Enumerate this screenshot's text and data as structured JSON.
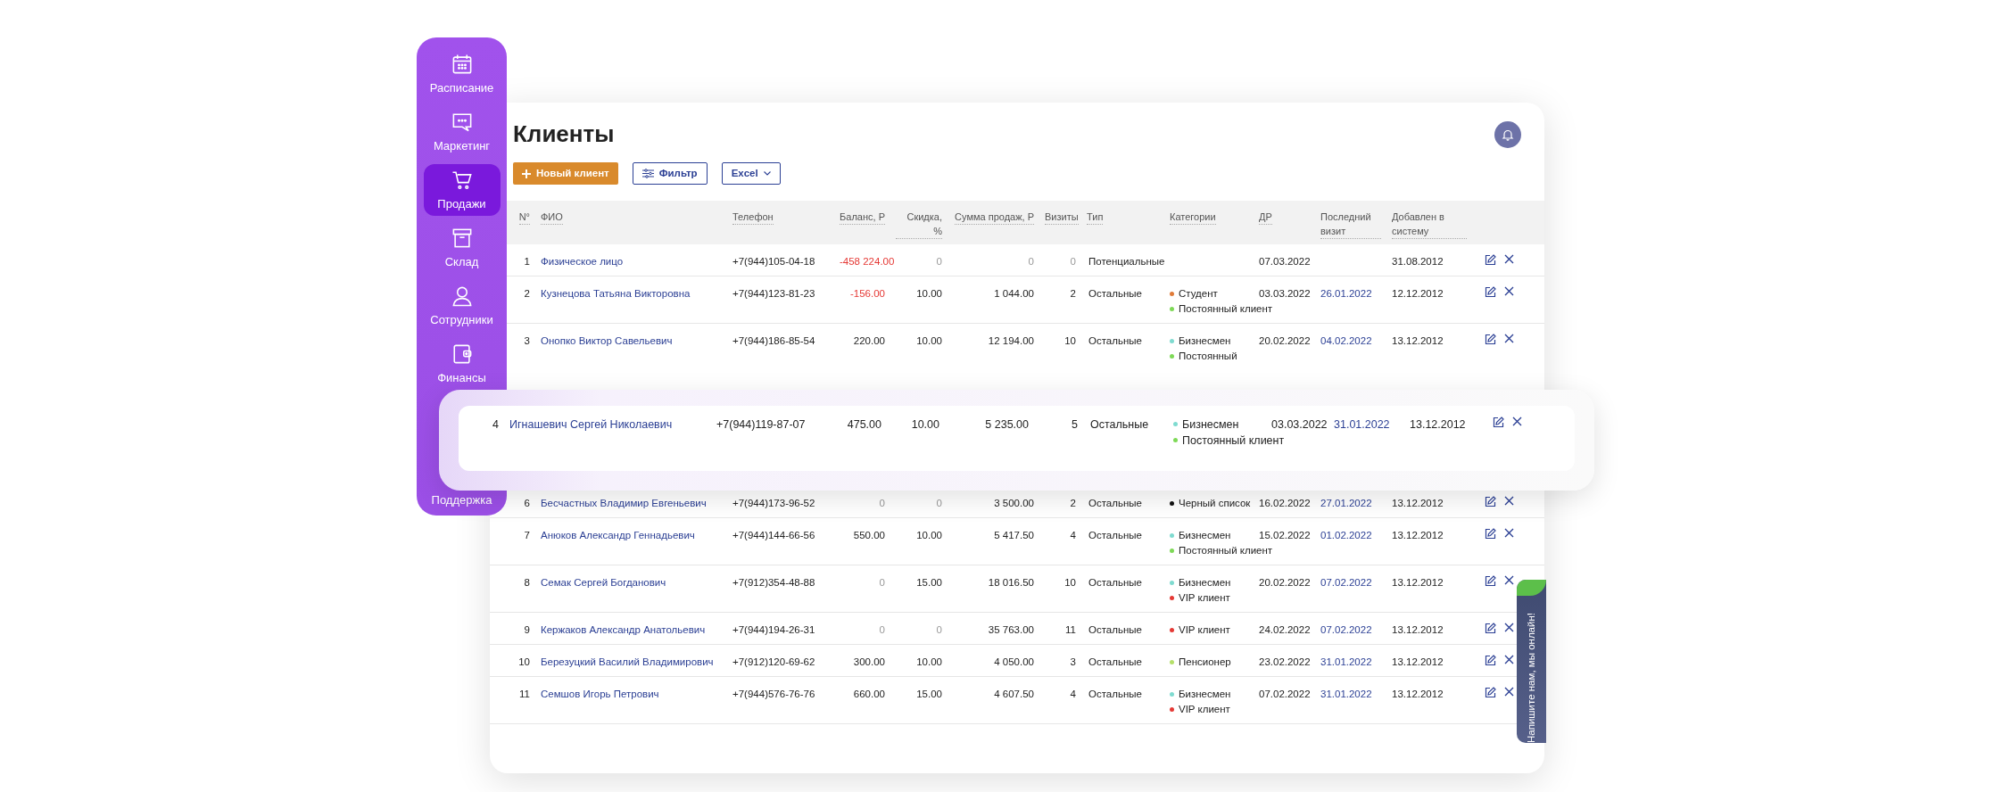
{
  "sidebar": {
    "items": [
      {
        "label": "Расписание",
        "selected": false
      },
      {
        "label": "Маркетинг",
        "selected": false
      },
      {
        "label": "Продажи",
        "selected": true
      },
      {
        "label": "Склад",
        "selected": false
      },
      {
        "label": "Сотрудники",
        "selected": false
      },
      {
        "label": "Финансы",
        "selected": false
      },
      {
        "label": "Поддержка",
        "selected": false
      }
    ]
  },
  "page": {
    "title": "Клиенты"
  },
  "toolbar": {
    "buttons": [
      {
        "label": "Новый клиент",
        "kind": "add"
      },
      {
        "label": "Фильтр",
        "kind": "filter"
      },
      {
        "label": "Excel",
        "kind": "dropdown"
      }
    ]
  },
  "table": {
    "columns": [
      "N°",
      "ФИО",
      "Телефон",
      "Баланс, Р",
      "Скидка, %",
      "Сумма продаж, Р",
      "Визиты",
      "Тип",
      "Категории",
      "ДР",
      "Последний визит",
      "Добавлен в систему"
    ],
    "rows": [
      {
        "number": "1",
        "name": "Физическое лицо",
        "phone": "+7(944)105-04-18",
        "balance": "-458 224.00",
        "balance_negative": true,
        "discount": "0",
        "discount_muted": true,
        "sales": "0",
        "sales_muted": true,
        "visits": "0",
        "visits_muted": true,
        "type": "Потенциальные",
        "categories": [],
        "birthday": "07.03.2022",
        "added": "31.08.2012"
      },
      {
        "number": "2",
        "name": "Кузнецова Татьяна Викторовна",
        "phone": "+7(944)123-81-23",
        "balance": "-156.00",
        "balance_negative": true,
        "discount": "10.00",
        "sales": "1 044.00",
        "visits": "2",
        "type": "Остальные",
        "categories": [
          {
            "label": "Студент",
            "color": "#e07b39"
          },
          {
            "label": "Постоянный клиент",
            "color": "#7ed957"
          }
        ],
        "birthday": "03.03.2022",
        "last_visit": "26.01.2022",
        "added": "12.12.2012"
      },
      {
        "number": "3",
        "name": "Онопко Виктор Савельевич",
        "phone": "+7(944)186-85-54",
        "balance": "220.00",
        "discount": "10.00",
        "sales": "12 194.00",
        "visits": "10",
        "type": "Остальные",
        "categories": [
          {
            "label": "Бизнесмен",
            "color": "#7fdbd0"
          },
          {
            "label": "Постоянный",
            "color": "#7ed957"
          }
        ],
        "birthday": "20.02.2022",
        "last_visit": "04.02.2022",
        "added": "13.12.2012"
      },
      {
        "number": "6",
        "name": "Бесчастных Владимир Евгеньевич",
        "phone": "+7(944)173-96-52",
        "balance": "0",
        "balance_muted": true,
        "discount": "0",
        "discount_muted": true,
        "sales": "3 500.00",
        "visits": "2",
        "type": "Остальные",
        "categories": [
          {
            "label": "Черный список",
            "color": "#111111"
          }
        ],
        "birthday": "16.02.2022",
        "last_visit": "27.01.2022",
        "added": "13.12.2012"
      },
      {
        "number": "7",
        "name": "Анюков Александр Геннадьевич",
        "phone": "+7(944)144-66-56",
        "balance": "550.00",
        "discount": "10.00",
        "sales": "5 417.50",
        "visits": "4",
        "type": "Остальные",
        "categories": [
          {
            "label": "Бизнесмен",
            "color": "#7fdbd0"
          },
          {
            "label": "Постоянный клиент",
            "color": "#7ed957"
          }
        ],
        "birthday": "15.02.2022",
        "last_visit": "01.02.2022",
        "added": "13.12.2012"
      },
      {
        "number": "8",
        "name": "Семак Сергей Богданович",
        "phone": "+7(912)354-48-88",
        "balance": "0",
        "balance_muted": true,
        "discount": "15.00",
        "sales": "18 016.50",
        "visits": "10",
        "type": "Остальные",
        "categories": [
          {
            "label": "Бизнесмен",
            "color": "#7fdbd0"
          },
          {
            "label": "VIP клиент",
            "color": "#e53935"
          }
        ],
        "birthday": "20.02.2022",
        "last_visit": "07.02.2022",
        "added": "13.12.2012"
      },
      {
        "number": "9",
        "name": "Кержаков Александр Анатольевич",
        "phone": "+7(944)194-26-31",
        "balance": "0",
        "balance_muted": true,
        "discount": "0",
        "discount_muted": true,
        "sales": "35 763.00",
        "visits": "11",
        "type": "Остальные",
        "categories": [
          {
            "label": "VIP клиент",
            "color": "#e53935"
          }
        ],
        "birthday": "24.02.2022",
        "last_visit": "07.02.2022",
        "added": "13.12.2012"
      },
      {
        "number": "10",
        "name": "Березуцкий Василий Владимирович",
        "phone": "+7(912)120-69-62",
        "balance": "300.00",
        "discount": "10.00",
        "sales": "4 050.00",
        "visits": "3",
        "type": "Остальные",
        "categories": [
          {
            "label": "Пенсионер",
            "color": "#b5e06a"
          }
        ],
        "birthday": "23.02.2022",
        "last_visit": "31.01.2022",
        "added": "13.12.2012"
      },
      {
        "number": "11",
        "name": "Семшов Игорь Петрович",
        "phone": "+7(944)576-76-76",
        "balance": "660.00",
        "discount": "15.00",
        "sales": "4 607.50",
        "visits": "4",
        "type": "Остальные",
        "categories": [
          {
            "label": "Бизнесмен",
            "color": "#7fdbd0"
          },
          {
            "label": "VIP клиент",
            "color": "#e53935"
          }
        ],
        "birthday": "07.02.2022",
        "last_visit": "31.01.2022",
        "added": "13.12.2012"
      }
    ]
  },
  "highlighted_row": {
    "number": "4",
    "name": "Игнашевич Сергей Николаевич",
    "phone": "+7(944)119-87-07",
    "balance": "475.00",
    "discount": "10.00",
    "sales": "5 235.00",
    "visits": "5",
    "type": "Остальные",
    "categories": [
      {
        "label": "Бизнесмен",
        "color": "#7fdbd0"
      },
      {
        "label": "Постоянный клиент",
        "color": "#7ed957"
      }
    ],
    "birthday": "03.03.2022",
    "last_visit": "31.01.2022",
    "added": "13.12.2012"
  },
  "chat_tab": {
    "label": "Напишите нам, мы онлайн!"
  }
}
